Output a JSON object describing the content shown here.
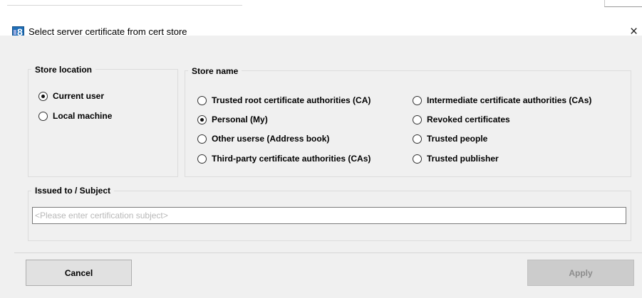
{
  "window": {
    "title": "Select server certificate from cert store",
    "icon_text": "8",
    "close_glyph": "×"
  },
  "store_location": {
    "label": "Store location",
    "options": [
      {
        "label": "Current user",
        "selected": true
      },
      {
        "label": "Local machine",
        "selected": false
      }
    ]
  },
  "store_name": {
    "label": "Store name",
    "options": [
      {
        "label": "Trusted root certificate authorities (CA)",
        "selected": false
      },
      {
        "label": "Personal (My)",
        "selected": true
      },
      {
        "label": "Other userse (Address book)",
        "selected": false
      },
      {
        "label": "Third-party certificate authorities (CAs)",
        "selected": false
      },
      {
        "label": "Intermediate certificate authorities (CAs)",
        "selected": false
      },
      {
        "label": "Revoked certificates",
        "selected": false
      },
      {
        "label": "Trusted people",
        "selected": false
      },
      {
        "label": "Trusted publisher",
        "selected": false
      }
    ]
  },
  "subject": {
    "label": "Issued to / Subject",
    "value": "",
    "placeholder": "<Please enter certification subject>"
  },
  "buttons": {
    "cancel": "Cancel",
    "apply": "Apply",
    "apply_enabled": false
  },
  "colors": {
    "client_bg": "#f0f0f0",
    "icon_blue": "#1f6fb8",
    "disabled_text": "#8c8c8c"
  }
}
